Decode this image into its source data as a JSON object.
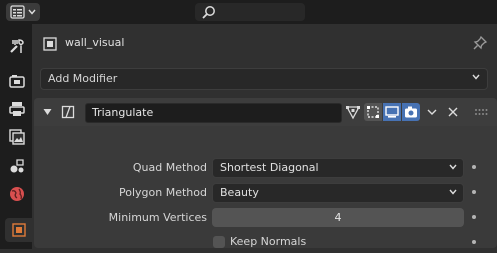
{
  "header": {
    "editor_type_icon": "properties-editor-icon",
    "search": {
      "placeholder": "",
      "icon": "search-icon"
    }
  },
  "tabs": [
    {
      "name": "tool",
      "icon": "tool-icon",
      "active": false
    },
    {
      "name": "render",
      "icon": "render-camera-icon",
      "active": false
    },
    {
      "name": "output",
      "icon": "output-printer-icon",
      "active": false
    },
    {
      "name": "view-layer",
      "icon": "view-layer-icon",
      "active": false
    },
    {
      "name": "scene",
      "icon": "scene-icon",
      "active": false
    },
    {
      "name": "world",
      "icon": "world-icon",
      "active": false
    },
    {
      "name": "object",
      "icon": "object-icon",
      "active": true
    }
  ],
  "context": {
    "object_name": "wall_visual",
    "pin_icon": "pin-icon"
  },
  "add_modifier": {
    "label": "Add Modifier"
  },
  "modifier": {
    "name": "Triangulate",
    "expanded": true,
    "toggles": [
      {
        "name": "edit-cage",
        "active": false
      },
      {
        "name": "edit-mode",
        "active": true
      },
      {
        "name": "viewport",
        "active": true
      },
      {
        "name": "render",
        "active": true
      }
    ],
    "properties": {
      "quad_method": {
        "label": "Quad Method",
        "value": "Shortest Diagonal"
      },
      "polygon_method": {
        "label": "Polygon Method",
        "value": "Beauty"
      },
      "minimum_vertices": {
        "label": "Minimum Vertices",
        "value": "4"
      },
      "keep_normals": {
        "label": "Keep Normals",
        "checked": false
      }
    }
  },
  "colors": {
    "accent": "#4772b3",
    "world_icon": "#d84f4f",
    "object_icon": "#e07b39"
  }
}
